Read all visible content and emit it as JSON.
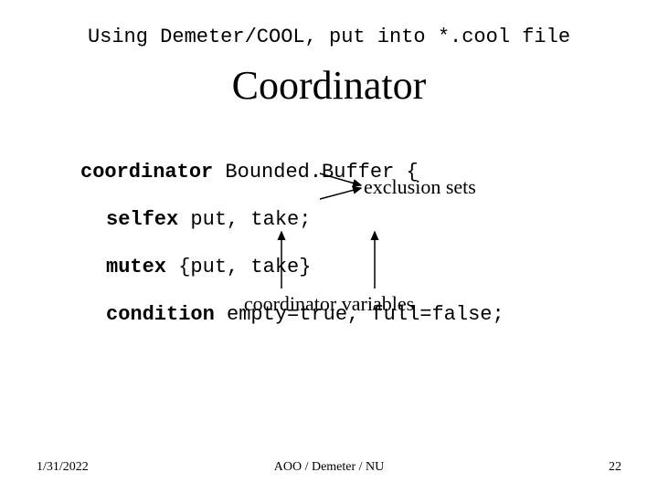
{
  "header": "Using Demeter/COOL, put into *.cool file",
  "title": "Coordinator",
  "code": {
    "kw_coordinator": "coordinator",
    "after_coordinator": " Bounded.Buffer {",
    "kw_selfex": "selfex",
    "after_selfex": " put, take;",
    "kw_mutex": "mutex",
    "after_mutex": " {put, take}",
    "kw_condition": "condition",
    "after_condition": " empty=true, full=false;"
  },
  "labels": {
    "exclusion": "exclusion sets",
    "coord_vars": "coordinator variables"
  },
  "footer": {
    "date": "1/31/2022",
    "center": "AOO / Demeter / NU",
    "page": "22"
  }
}
